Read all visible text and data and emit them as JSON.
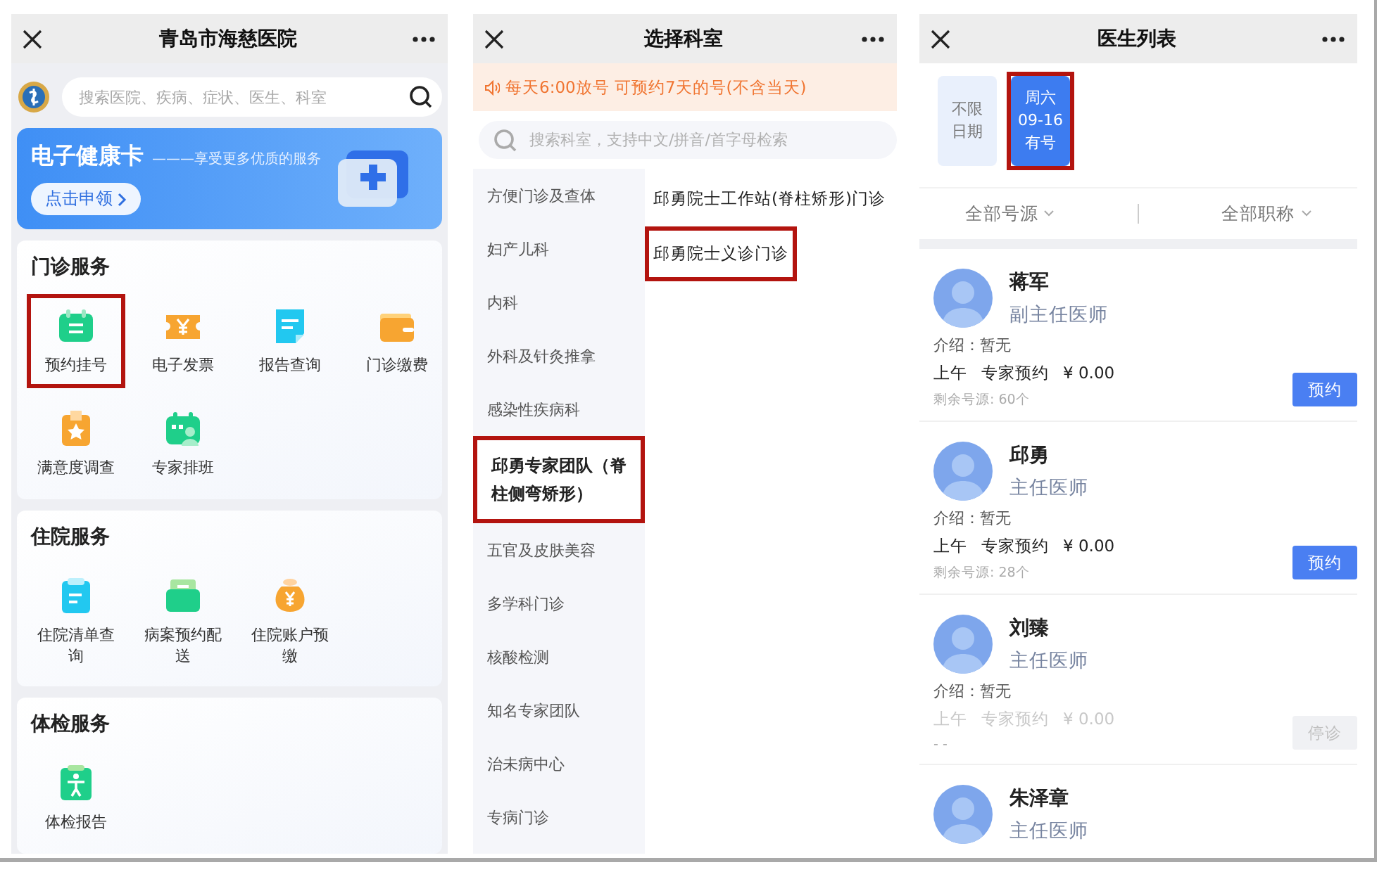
{
  "home": {
    "title": "青岛市海慈医院",
    "search": {
      "placeholder": "搜索医院、疾病、症状、医生、科室"
    },
    "banner": {
      "title": "电子健康卡",
      "subtitle": "———享受更多优质的服务",
      "button": "点击申领"
    },
    "sections": [
      {
        "title": "门诊服务",
        "items": [
          {
            "label": "预约挂号",
            "highlighted": true
          },
          {
            "label": "电子发票",
            "highlighted": false
          },
          {
            "label": "报告查询",
            "highlighted": false
          },
          {
            "label": "门诊缴费",
            "highlighted": false
          },
          {
            "label": "满意度调查",
            "highlighted": false
          },
          {
            "label": "专家排班",
            "highlighted": false
          }
        ]
      },
      {
        "title": "住院服务",
        "items": [
          {
            "label": "住院清单查询",
            "highlighted": false
          },
          {
            "label": "病案预约配送",
            "highlighted": false
          },
          {
            "label": "住院账户预缴",
            "highlighted": false
          }
        ]
      },
      {
        "title": "体检服务",
        "items": [
          {
            "label": "体检报告",
            "highlighted": false
          }
        ]
      }
    ]
  },
  "departments": {
    "title": "选择科室",
    "notice": "每天6:00放号 可预约7天的号(不含当天)",
    "search": {
      "placeholder": "搜索科室，支持中文/拼音/首字母检索"
    },
    "categories": [
      {
        "label": "方便门诊及查体",
        "selected": false,
        "highlighted": false
      },
      {
        "label": "妇产儿科",
        "selected": false,
        "highlighted": false
      },
      {
        "label": "内科",
        "selected": false,
        "highlighted": false
      },
      {
        "label": "外科及针灸推拿",
        "selected": false,
        "highlighted": false
      },
      {
        "label": "感染性疾病科",
        "selected": false,
        "highlighted": false
      },
      {
        "label": "邱勇专家团队（脊柱侧弯矫形）",
        "selected": true,
        "highlighted": true
      },
      {
        "label": "五官及皮肤美容",
        "selected": false,
        "highlighted": false
      },
      {
        "label": "多学科门诊",
        "selected": false,
        "highlighted": false
      },
      {
        "label": "核酸检测",
        "selected": false,
        "highlighted": false
      },
      {
        "label": "知名专家团队",
        "selected": false,
        "highlighted": false
      },
      {
        "label": "治未病中心",
        "selected": false,
        "highlighted": false
      },
      {
        "label": "专病门诊",
        "selected": false,
        "highlighted": false
      }
    ],
    "clinics": [
      {
        "label": "邱勇院士工作站(脊柱矫形)门诊",
        "highlighted": false
      },
      {
        "label": "邱勇院士义诊门诊",
        "highlighted": true
      }
    ]
  },
  "doctors": {
    "title": "医生列表",
    "dates": [
      {
        "lines": [
          "不限",
          "日期"
        ],
        "selected": false,
        "highlighted": false
      },
      {
        "lines": [
          "周六",
          "09-16",
          "有号"
        ],
        "selected": true,
        "highlighted": true
      }
    ],
    "filters": [
      "全部号源",
      "全部职称"
    ],
    "list": [
      {
        "name": "蒋军",
        "title": "副主任医师",
        "intro": "介绍：暂无",
        "session": "上午",
        "type": "专家预约",
        "price": "¥ 0.00",
        "remaining": "剩余号源: 60个",
        "action": "预约",
        "disabled": false
      },
      {
        "name": "邱勇",
        "title": "主任医师",
        "intro": "介绍：暂无",
        "session": "上午",
        "type": "专家预约",
        "price": "¥ 0.00",
        "remaining": "剩余号源: 28个",
        "action": "预约",
        "disabled": false
      },
      {
        "name": "刘臻",
        "title": "主任医师",
        "intro": "介绍：暂无",
        "session": "上午",
        "type": "专家预约",
        "price": "¥ 0.00",
        "remaining": "- -",
        "action": "停诊",
        "disabled": true
      },
      {
        "name": "朱泽章",
        "title": "主任医师"
      }
    ]
  }
}
